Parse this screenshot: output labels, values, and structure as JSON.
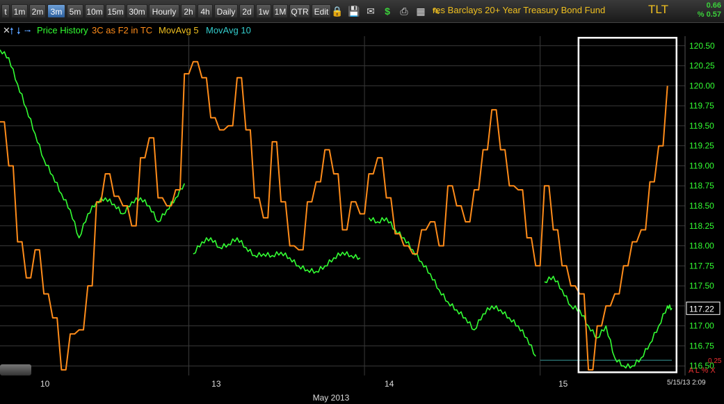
{
  "toolbar": {
    "timeframes": [
      "t",
      "1m",
      "2m",
      "3m",
      "5m",
      "10m",
      "15m",
      "30m",
      "Hourly",
      "2h",
      "4h",
      "Daily",
      "2d",
      "1w",
      "1M",
      "QTR",
      "Edit"
    ],
    "active": "3m",
    "fund_name": "res Barclays 20+ Year Treasury Bond Fund",
    "ticker": "TLT",
    "change_1": "0.66",
    "change_2": "% 0.57",
    "icons": [
      "lock-icon",
      "save-icon",
      "mail-icon",
      "dollar-icon",
      "print-icon",
      "table-icon",
      "pencil-icon"
    ]
  },
  "legend": {
    "price_history": "Price History",
    "three_c": "3C as F2 in TC",
    "mavg5": "MovAvg 5",
    "mavg10": "MovAvg 10"
  },
  "footer": {
    "month": "May 2013",
    "timestamp": "5/15/13 2:09",
    "indicator_value": "0.25",
    "controls": "A L % X"
  },
  "colors": {
    "price": "#33ff33",
    "three_c": "#ff8c1a",
    "mavg5": "#f0c020",
    "mavg10": "#33cccc",
    "grid": "#3a3a3a",
    "highlight_box": "#ffffff"
  },
  "chart_data": {
    "type": "line",
    "yticks": [
      120.5,
      120.25,
      120.0,
      119.75,
      119.5,
      119.25,
      119.0,
      118.75,
      118.5,
      118.25,
      118.0,
      117.75,
      117.5,
      117.25,
      117.0,
      116.75,
      116.5
    ],
    "ylim": [
      116.38,
      120.62
    ],
    "xlabels": [
      "10",
      "13",
      "14",
      "15"
    ],
    "xlabel": "May 2013",
    "last_price": "117.22",
    "reference_level": 116.57,
    "highlight_range": {
      "x": [
        65,
        76
      ],
      "y": [
        116.42,
        120.6
      ]
    },
    "series": [
      {
        "name": "Price History",
        "color": "#33ff33",
        "points": [
          [
            0,
            120.45
          ],
          [
            1,
            120.35
          ],
          [
            2,
            120.02
          ],
          [
            3,
            119.72
          ],
          [
            4,
            119.4
          ],
          [
            5,
            119.08
          ],
          [
            6,
            118.88
          ],
          [
            7,
            118.65
          ],
          [
            8,
            118.45
          ],
          [
            9,
            118.1
          ],
          [
            10,
            118.4
          ],
          [
            11,
            118.55
          ],
          [
            12,
            118.6
          ],
          [
            13,
            118.52
          ],
          [
            14,
            118.4
          ],
          [
            15,
            118.55
          ],
          [
            16,
            118.6
          ],
          [
            17,
            118.5
          ],
          [
            18,
            118.3
          ],
          [
            19,
            118.45
          ],
          [
            20,
            118.6
          ],
          [
            21,
            118.78
          ],
          [
            null,
            null
          ],
          [
            22,
            117.9
          ],
          [
            23,
            118.05
          ],
          [
            24,
            118.1
          ],
          [
            25,
            117.98
          ],
          [
            26,
            118.02
          ],
          [
            27,
            118.1
          ],
          [
            28,
            117.98
          ],
          [
            29,
            117.88
          ],
          [
            30,
            117.9
          ],
          [
            31,
            117.88
          ],
          [
            32,
            117.92
          ],
          [
            33,
            117.85
          ],
          [
            34,
            117.75
          ],
          [
            35,
            117.7
          ],
          [
            36,
            117.68
          ],
          [
            37,
            117.75
          ],
          [
            38,
            117.85
          ],
          [
            39,
            117.92
          ],
          [
            40,
            117.88
          ],
          [
            41,
            117.85
          ],
          [
            null,
            null
          ],
          [
            42,
            118.35
          ],
          [
            43,
            118.3
          ],
          [
            44,
            118.35
          ],
          [
            45,
            118.2
          ],
          [
            46,
            118.1
          ],
          [
            47,
            117.95
          ],
          [
            48,
            117.8
          ],
          [
            49,
            117.65
          ],
          [
            50,
            117.45
          ],
          [
            51,
            117.3
          ],
          [
            52,
            117.2
          ],
          [
            53,
            117.1
          ],
          [
            54,
            116.95
          ],
          [
            55,
            117.15
          ],
          [
            56,
            117.25
          ],
          [
            57,
            117.2
          ],
          [
            58,
            117.1
          ],
          [
            59,
            117.0
          ],
          [
            60,
            116.85
          ],
          [
            61,
            116.62
          ],
          [
            null,
            null
          ],
          [
            62,
            117.55
          ],
          [
            63,
            117.62
          ],
          [
            64,
            117.45
          ],
          [
            65,
            117.25
          ],
          [
            66,
            117.2
          ],
          [
            67,
            117.0
          ],
          [
            68,
            116.85
          ],
          [
            69,
            117.0
          ],
          [
            70,
            116.6
          ],
          [
            71,
            116.5
          ],
          [
            72,
            116.5
          ],
          [
            73,
            116.6
          ],
          [
            74,
            116.78
          ],
          [
            75,
            117.0
          ],
          [
            76,
            117.25
          ],
          [
            76.5,
            117.22
          ]
        ]
      },
      {
        "name": "3C as F2 in TC",
        "color": "#ff8c1a",
        "points": [
          [
            0,
            119.55
          ],
          [
            1,
            119.0
          ],
          [
            2,
            118.05
          ],
          [
            3,
            117.6
          ],
          [
            4,
            117.95
          ],
          [
            5,
            117.4
          ],
          [
            6,
            117.1
          ],
          [
            7,
            116.45
          ],
          [
            8,
            116.9
          ],
          [
            9,
            116.95
          ],
          [
            10,
            117.5
          ],
          [
            11,
            118.55
          ],
          [
            12,
            118.9
          ],
          [
            13,
            118.62
          ],
          [
            14,
            118.5
          ],
          [
            15,
            118.25
          ],
          [
            16,
            119.1
          ],
          [
            17,
            119.35
          ],
          [
            18,
            118.6
          ],
          [
            19,
            118.5
          ],
          [
            20,
            118.7
          ],
          [
            21,
            120.15
          ],
          [
            22,
            120.3
          ],
          [
            23,
            120.1
          ],
          [
            24,
            119.6
          ],
          [
            25,
            119.45
          ],
          [
            26,
            119.5
          ],
          [
            27,
            120.1
          ],
          [
            28,
            119.45
          ],
          [
            29,
            118.6
          ],
          [
            30,
            118.35
          ],
          [
            31,
            119.3
          ],
          [
            32,
            118.55
          ],
          [
            33,
            118.0
          ],
          [
            34,
            117.95
          ],
          [
            35,
            118.55
          ],
          [
            36,
            118.8
          ],
          [
            37,
            119.2
          ],
          [
            38,
            118.9
          ],
          [
            39,
            118.2
          ],
          [
            40,
            118.55
          ],
          [
            41,
            118.4
          ],
          [
            42,
            118.9
          ],
          [
            43,
            119.1
          ],
          [
            44,
            118.6
          ],
          [
            45,
            118.15
          ],
          [
            46,
            118.0
          ],
          [
            47,
            117.9
          ],
          [
            48,
            118.2
          ],
          [
            49,
            118.3
          ],
          [
            50,
            118.0
          ],
          [
            51,
            118.75
          ],
          [
            52,
            118.5
          ],
          [
            53,
            118.3
          ],
          [
            54,
            118.7
          ],
          [
            55,
            119.2
          ],
          [
            56,
            119.7
          ],
          [
            57,
            119.2
          ],
          [
            58,
            118.75
          ],
          [
            59,
            118.7
          ],
          [
            60,
            118.1
          ],
          [
            61,
            117.75
          ],
          [
            62,
            118.75
          ],
          [
            63,
            118.2
          ],
          [
            64,
            117.75
          ],
          [
            65,
            117.5
          ],
          [
            66,
            117.4
          ],
          [
            67,
            116.45
          ],
          [
            68,
            117.0
          ],
          [
            69,
            117.25
          ],
          [
            70,
            117.4
          ],
          [
            71,
            117.75
          ],
          [
            72,
            118.05
          ],
          [
            73,
            118.2
          ],
          [
            74,
            118.8
          ],
          [
            75,
            119.25
          ],
          [
            76,
            120.0
          ]
        ]
      }
    ]
  }
}
